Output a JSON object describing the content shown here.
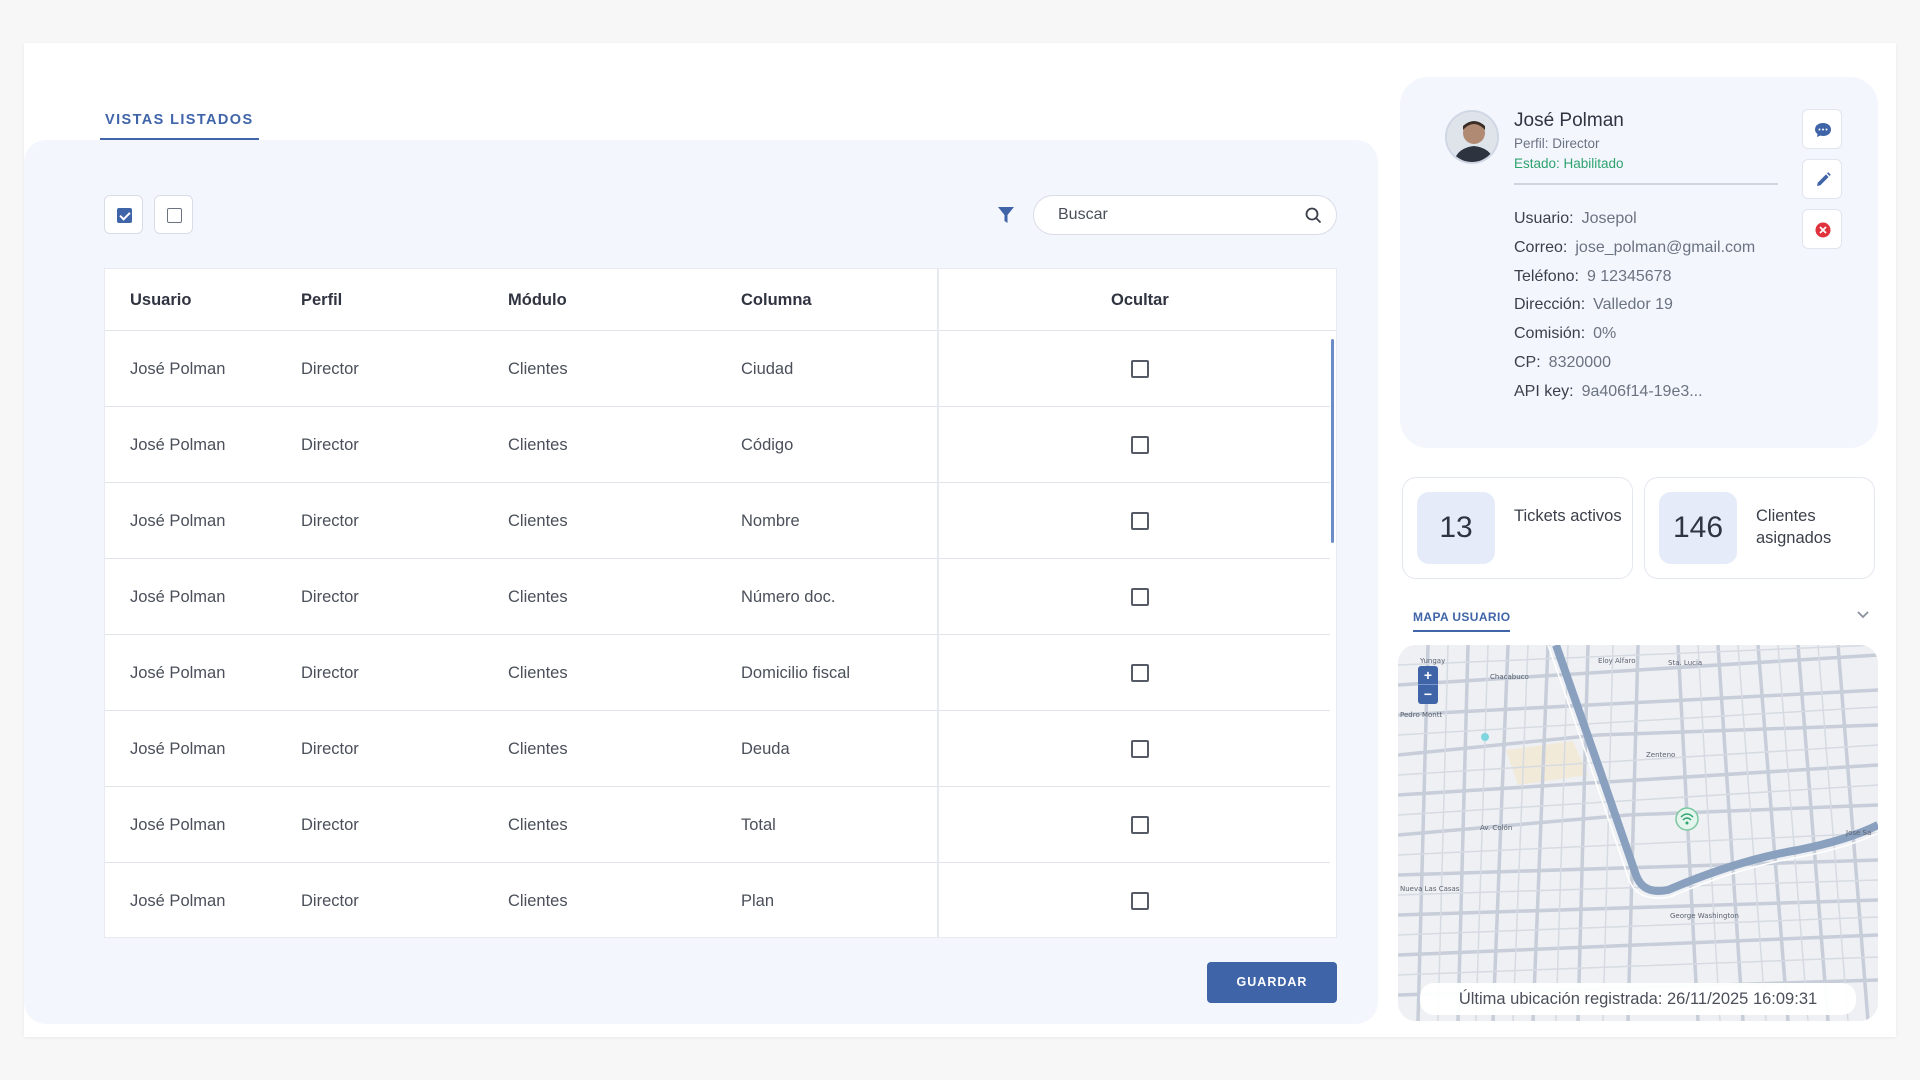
{
  "left": {
    "tab_label": "VISTAS LISTADOS",
    "search_placeholder": "Buscar",
    "columns": {
      "usuario": "Usuario",
      "perfil": "Perfil",
      "modulo": "Módulo",
      "columna": "Columna",
      "ocultar": "Ocultar"
    },
    "rows": [
      {
        "usuario": "José Polman",
        "perfil": "Director",
        "modulo": "Clientes",
        "columna": "Ciudad",
        "ocultar": false
      },
      {
        "usuario": "José Polman",
        "perfil": "Director",
        "modulo": "Clientes",
        "columna": "Código",
        "ocultar": false
      },
      {
        "usuario": "José Polman",
        "perfil": "Director",
        "modulo": "Clientes",
        "columna": "Nombre",
        "ocultar": false
      },
      {
        "usuario": "José Polman",
        "perfil": "Director",
        "modulo": "Clientes",
        "columna": "Número doc.",
        "ocultar": false
      },
      {
        "usuario": "José Polman",
        "perfil": "Director",
        "modulo": "Clientes",
        "columna": "Domicilio fiscal",
        "ocultar": false
      },
      {
        "usuario": "José Polman",
        "perfil": "Director",
        "modulo": "Clientes",
        "columna": "Deuda",
        "ocultar": false
      },
      {
        "usuario": "José Polman",
        "perfil": "Director",
        "modulo": "Clientes",
        "columna": "Total",
        "ocultar": false
      },
      {
        "usuario": "José Polman",
        "perfil": "Director",
        "modulo": "Clientes",
        "columna": "Plan",
        "ocultar": false
      }
    ],
    "save_label": "GUARDAR"
  },
  "profile": {
    "name": "José Polman",
    "perfil": "Perfil: Director",
    "estado": "Estado: Habilitado",
    "fields": {
      "usuario": {
        "label": "Usuario:",
        "value": "Josepol"
      },
      "correo": {
        "label": "Correo:",
        "value": "jose_polman@gmail.com"
      },
      "telefono": {
        "label": "Teléfono:",
        "value": "9 12345678"
      },
      "direccion": {
        "label": "Dirección:",
        "value": "Valledor 19"
      },
      "comision": {
        "label": "Comisión:",
        "value": "0%"
      },
      "cp": {
        "label": "CP:",
        "value": "8320000"
      },
      "api": {
        "label": "API key:",
        "value": "9a406f14-19e3..."
      }
    }
  },
  "stats": [
    {
      "value": "13",
      "label": "Tickets activos"
    },
    {
      "value": "146",
      "label": "Clientes asignados"
    }
  ],
  "map": {
    "tab_label": "MAPA USUARIO",
    "zoom_in": "+",
    "zoom_out": "−",
    "status": "Última ubicación registrada: 26/11/2025 16:09:31",
    "street_labels": [
      "Yungay",
      "Chacabuco",
      "Eloy Alfaro",
      "Sta. Lucia",
      "Pedro Montt",
      "Zenteno",
      "Av. Colón",
      "Nueva Las Casas",
      "George Washington",
      "Jose Sa"
    ]
  },
  "colors": {
    "accent": "#3f64a8",
    "success": "#2ea36e",
    "danger": "#e0323c",
    "panel_bg": "#f3f6fd"
  }
}
